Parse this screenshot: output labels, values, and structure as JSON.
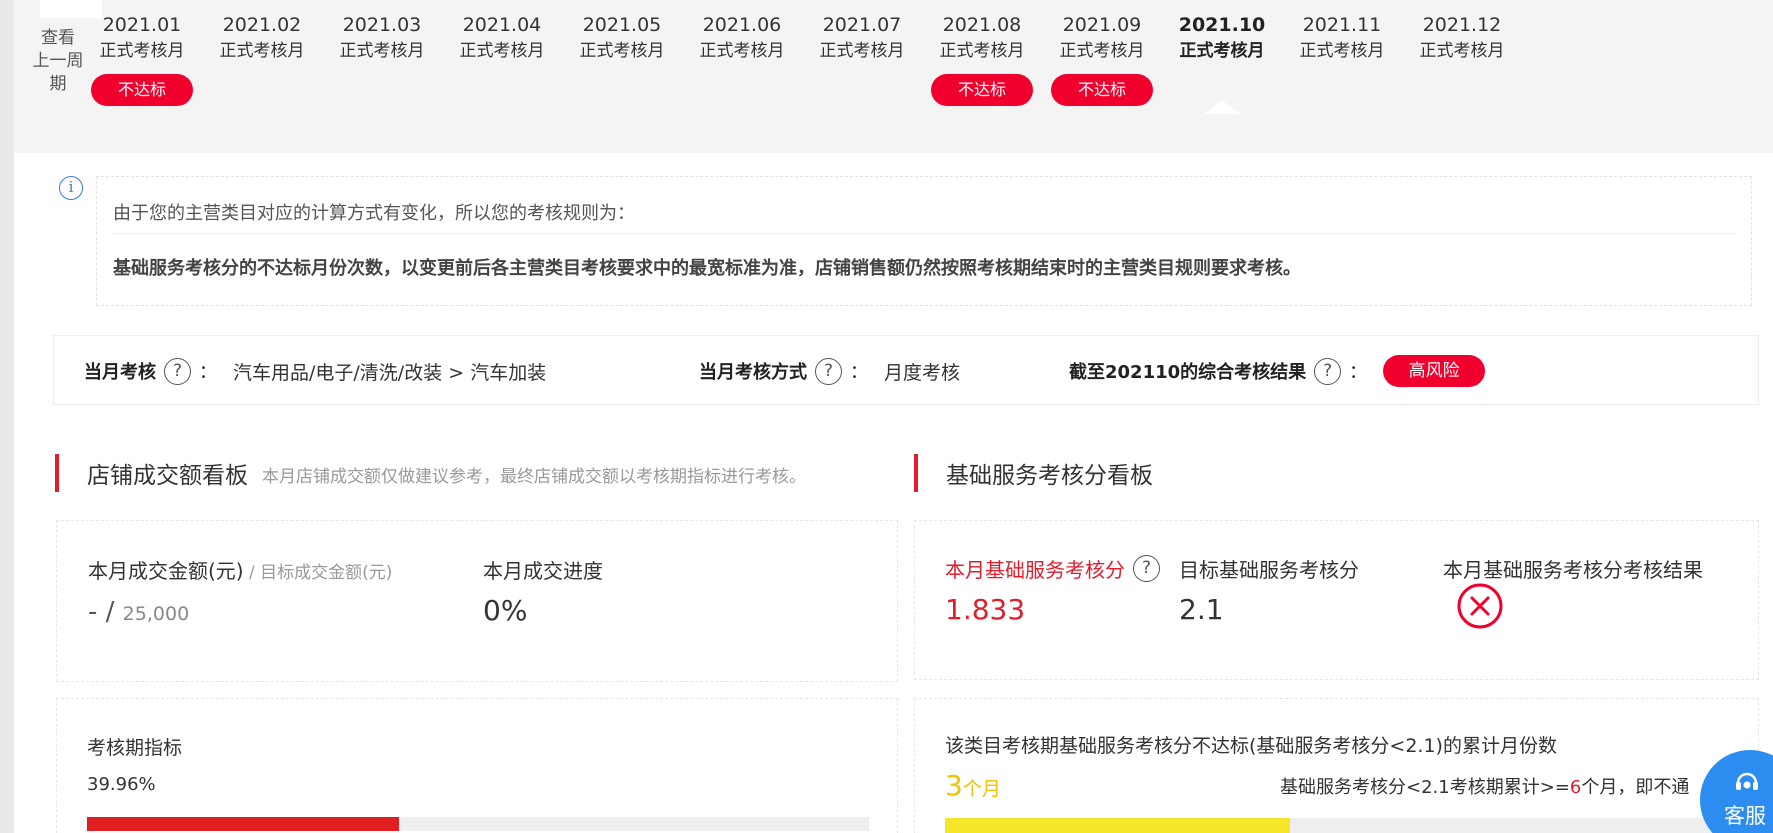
{
  "prev_cycle": {
    "line1": "查看",
    "line2": "上一周期"
  },
  "months": [
    {
      "date": "2021.01",
      "type": "正式考核月",
      "badge": "不达标",
      "active": false
    },
    {
      "date": "2021.02",
      "type": "正式考核月",
      "badge": "",
      "active": false
    },
    {
      "date": "2021.03",
      "type": "正式考核月",
      "badge": "",
      "active": false
    },
    {
      "date": "2021.04",
      "type": "正式考核月",
      "badge": "",
      "active": false
    },
    {
      "date": "2021.05",
      "type": "正式考核月",
      "badge": "",
      "active": false
    },
    {
      "date": "2021.06",
      "type": "正式考核月",
      "badge": "",
      "active": false
    },
    {
      "date": "2021.07",
      "type": "正式考核月",
      "badge": "",
      "active": false
    },
    {
      "date": "2021.08",
      "type": "正式考核月",
      "badge": "不达标",
      "active": false
    },
    {
      "date": "2021.09",
      "type": "正式考核月",
      "badge": "不达标",
      "active": false
    },
    {
      "date": "2021.10",
      "type": "正式考核月",
      "badge": "",
      "active": true
    },
    {
      "date": "2021.11",
      "type": "正式考核月",
      "badge": "",
      "active": false
    },
    {
      "date": "2021.12",
      "type": "正式考核月",
      "badge": "",
      "active": false
    }
  ],
  "info": {
    "icon": "info-icon",
    "icon_glyph": "i",
    "line1": "由于您的主营类目对应的计算方式有变化，所以您的考核规则为：",
    "line2": "基础服务考核分的不达标月份次数，以变更前后各主营类目考核要求中的最宽标准为准，店铺销售额仍然按照考核期结束时的主营类目规则要求考核。"
  },
  "summary": {
    "q_glyph": "?",
    "colon": "：",
    "category_label": "当月考核",
    "category_value": "汽车用品/电子/清洗/改装 > 汽车加装",
    "method_label": "当月考核方式",
    "method_value": "月度考核",
    "result_label": "截至202110的综合考核结果",
    "result_badge": "高风险"
  },
  "sales_board": {
    "title": "店铺成交额看板",
    "note": "本月店铺成交额仅做建议参考，最终店铺成交额以考核期指标进行考核。",
    "amount_label": "本月成交金额(元)",
    "amount_sep": " / ",
    "target_label": "目标成交金额(元)",
    "amount_value": "- / ",
    "target_value": "25,000",
    "progress_label": "本月成交进度",
    "progress_value": "0%",
    "period_label": "考核期指标",
    "period_value": "39.96%",
    "period_fraction": 0.3996
  },
  "service_board": {
    "title": "基础服务考核分看板",
    "score_label": "本月基础服务考核分",
    "score_value": "1.833",
    "target_label": "目标基础服务考核分",
    "target_value": "2.1",
    "result_label": "本月基础服务考核分考核结果",
    "result_icon": "fail-circle-x-icon",
    "cum_label": "该类目考核期基础服务考核分不达标(基础服务考核分<2.1)的累计月份数",
    "cum_value": "3",
    "cum_unit": "个月",
    "cum_rule_pre": "基础服务考核分<2.1考核期累计>=",
    "cum_rule_num": "6",
    "cum_rule_post": "个月，即不通",
    "cum_fraction": 0.43
  },
  "colors": {
    "accent_red": "#f0002c",
    "bar_red": "#e02020",
    "bar_yellow": "#f5e627",
    "cs_blue": "#2d8cf0"
  },
  "cs_button": {
    "icon": "headset-icon",
    "label": "客服"
  }
}
